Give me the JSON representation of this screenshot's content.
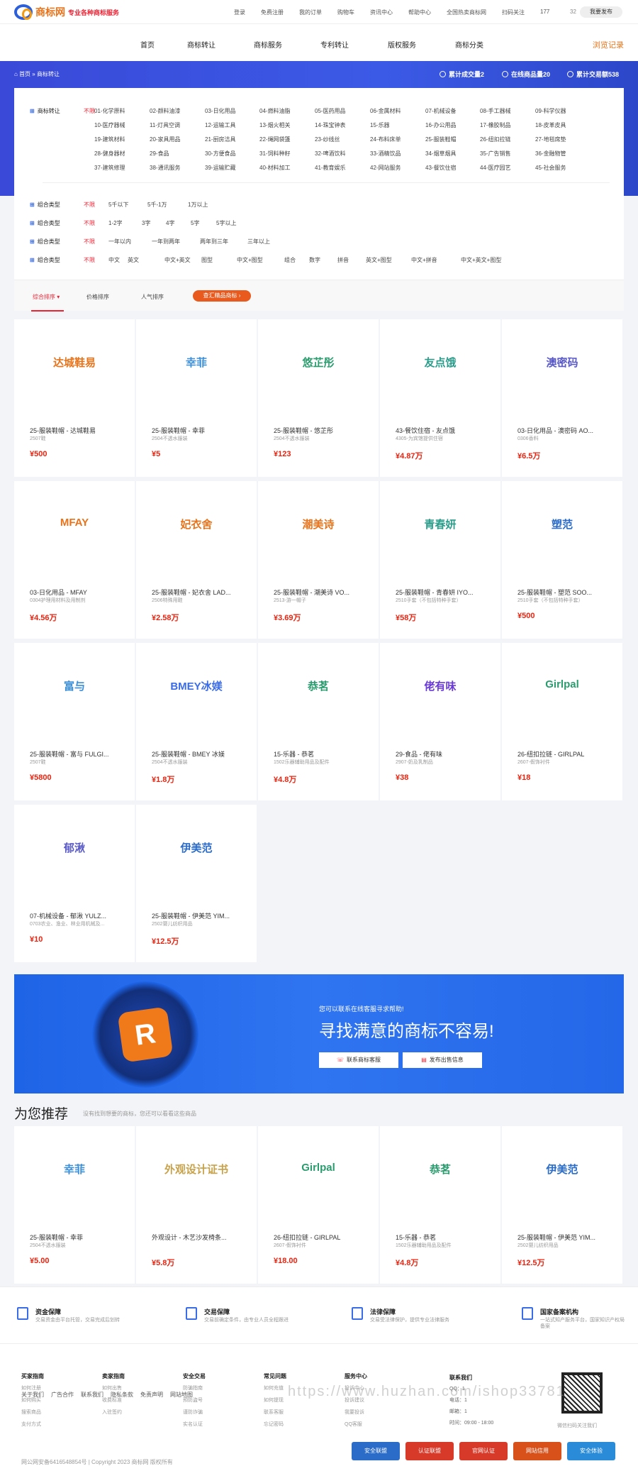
{
  "brand": {
    "name": "商标网",
    "tagline": "专业各种商标服务"
  },
  "toplinks": [
    "登录",
    "免费注册",
    "我的订单",
    "购物车",
    "资讯中心",
    "帮助中心",
    "全国热卖商标网",
    "扫码关注",
    "177"
  ],
  "top_count": "32",
  "top_publish": "我要发布",
  "nav": [
    "首页",
    "商标转让",
    "商标服务",
    "专利转让",
    "版权服务",
    "商标分类"
  ],
  "nav_history": "浏览记录",
  "breadcrumb": "首页 » 商标转让",
  "stats": [
    "累计成交量2",
    "在线商品量20",
    "累计交易额538"
  ],
  "filter": {
    "label_category": "商标转让",
    "nolimit": "不限",
    "categories": [
      "01-化学原料",
      "02-颜料油漆",
      "03-日化用品",
      "04-燃料油脂",
      "05-医药用品",
      "06-金属材料",
      "07-机械设备",
      "08-手工器械",
      "09-科学仪器",
      "10-医疗器械",
      "11-灯具空调",
      "12-运输工具",
      "13-烟火相关",
      "14-珠宝钟表",
      "15-乐器",
      "16-办公用品",
      "17-橡胶制品",
      "18-皮革皮具",
      "19-建筑材料",
      "20-家具用品",
      "21-厨房洁具",
      "22-绳网袋篷",
      "23-纱线丝",
      "24-布料床单",
      "25-服装鞋帽",
      "26-纽扣拉链",
      "27-地毯席垫",
      "28-健身器材",
      "29-食品",
      "30-方便食品",
      "31-饲料种籽",
      "32-啤酒饮料",
      "33-酒精饮品",
      "34-烟草烟具",
      "35-广告销售",
      "36-金融物管",
      "37-建筑修理",
      "38-通讯服务",
      "39-运输贮藏",
      "40-材料加工",
      "41-教育娱乐",
      "42-网站服务",
      "43-餐饮住宿",
      "44-医疗园艺",
      "45-社会服务"
    ],
    "group_label": "组合类型",
    "rows": [
      [
        "5千以下",
        "5千-1万",
        "1万以上"
      ],
      [
        "1-2字",
        "3字",
        "4字",
        "5字",
        "5字以上"
      ],
      [
        "一年以内",
        "一年到两年",
        "两年到三年",
        "三年以上"
      ],
      [
        "中文",
        "英文",
        "中文+英文",
        "图型",
        "中文+图型",
        "组合",
        "数字",
        "拼音",
        "英文+图型",
        "中文+拼音",
        "中文+英文+图型"
      ]
    ]
  },
  "sort": {
    "items": [
      "综合排序",
      "价格排序",
      "人气排序"
    ],
    "bid": "查汇精品商标 ›"
  },
  "colors": {
    "accent": "#e8230f",
    "blue": "#3b6ce8",
    "orange": "#e8731a"
  },
  "listings": [
    {
      "logo": "达城鞋易",
      "color": "#e8731a",
      "title": "25-服装鞋帽 - 达城鞋易",
      "sub": "2507鞋",
      "price": "¥500"
    },
    {
      "logo": "幸菲",
      "color": "#3b8fd8",
      "title": "25-服装鞋帽 - 幸菲",
      "sub": "2504不透水服装",
      "price": "¥5"
    },
    {
      "logo": "悠芷彤",
      "color": "#2a9c6e",
      "title": "25-服装鞋帽 - 悠芷彤",
      "sub": "2504不透水服装",
      "price": "¥123"
    },
    {
      "logo": "友点饿",
      "color": "#2a9c8a",
      "title": "43-餐饮住宿 - 友点饿",
      "sub": "4305-为宾馆提供住宿",
      "price": "¥4.87万"
    },
    {
      "logo": "澳密码",
      "color": "#5a5ac8",
      "title": "03-日化用品 - 澳密码 AO...",
      "sub": "0306香料",
      "price": "¥6.5万"
    },
    {
      "logo": "MFAY",
      "color": "#e8731a",
      "title": "03-日化用品 - MFAY",
      "sub": "0304护理用材料及用制剂",
      "price": "¥4.56万"
    },
    {
      "logo": "妃衣舍",
      "color": "#e8731a",
      "title": "25-服装鞋帽 - 妃衣舍 LAD...",
      "sub": "2506特殊用鞋",
      "price": "¥2.58万"
    },
    {
      "logo": "潮美诗",
      "color": "#e8731a",
      "title": "25-服装鞋帽 - 潮美诗 VO...",
      "sub": "2513-游一帽子",
      "price": "¥3.69万"
    },
    {
      "logo": "青春妍",
      "color": "#2a9c8a",
      "title": "25-服装鞋帽 - 青春妍 IYO...",
      "sub": "2510手套（不包括特种手套）",
      "price": "¥58万"
    },
    {
      "logo": "塑范",
      "color": "#2a6cc8",
      "title": "25-服装鞋帽 - 塑范 SOO...",
      "sub": "2510手套（不包括特种手套）",
      "price": "¥500"
    },
    {
      "logo": "富与",
      "color": "#3b8fd8",
      "title": "25-服装鞋帽 - 富与 FULGI...",
      "sub": "2507鞋",
      "price": "¥5800"
    },
    {
      "logo": "BMEY冰媄",
      "color": "#3b6ce8",
      "title": "25-服装鞋帽 - BMEY 冰媄",
      "sub": "2504不透水服装",
      "price": "¥1.8万"
    },
    {
      "logo": "恭茗",
      "color": "#2a9c6e",
      "title": "15-乐器 - 恭茗",
      "sub": "1502乐器辅助用品及配件",
      "price": "¥4.8万"
    },
    {
      "logo": "佬有味",
      "color": "#6a3ad8",
      "title": "29-食品 - 佬有味",
      "sub": "2907-奶及乳制品",
      "price": "¥38"
    },
    {
      "logo": "Girlpal",
      "color": "#2a9c6e",
      "title": "26-纽扣拉链 - GIRLPAL",
      "sub": "2607-假饰衬件",
      "price": "¥18"
    },
    {
      "logo": "郁湫",
      "color": "#5a5ac8",
      "title": "07-机械设备 - 郁湫 YULZ...",
      "sub": "0703农业、渔业、林业用机械及...",
      "price": "¥10"
    },
    {
      "logo": "伊美范",
      "color": "#2a6cc8",
      "title": "25-服装鞋帽 - 伊美范 YIM...",
      "sub": "2502婴儿纺织用品",
      "price": "¥12.5万"
    }
  ],
  "promo": {
    "small": "您可以联系在线客服寻求帮助!",
    "big": "寻找满意的商标不容易!",
    "btn1": "联系商标客服",
    "btn2": "发布出售信息"
  },
  "recommend": {
    "title": "为您推荐",
    "sub": "没有找到想要的商标，您还可以看看这些商品"
  },
  "recs": [
    {
      "logo": "幸菲",
      "color": "#3b8fd8",
      "title": "25-服装鞋帽 - 幸菲",
      "sub": "2504不透水服装",
      "price": "¥5.00"
    },
    {
      "logo": "外观设计证书",
      "color": "#c8a24a",
      "title": "外观设计 - 木艺沙发椅条...",
      "sub": "",
      "price": "¥5.8万"
    },
    {
      "logo": "Girlpal",
      "color": "#2a9c6e",
      "title": "26-纽扣拉链 - GIRLPAL",
      "sub": "2607-假饰衬件",
      "price": "¥18.00"
    },
    {
      "logo": "恭茗",
      "color": "#2a9c6e",
      "title": "15-乐器 - 恭茗",
      "sub": "1502乐器辅助用品及配件",
      "price": "¥4.8万"
    },
    {
      "logo": "伊美范",
      "color": "#2a6cc8",
      "title": "25-服装鞋帽 - 伊美范 YIM...",
      "sub": "2502婴儿纺织用品",
      "price": "¥12.5万"
    }
  ],
  "guarantees": [
    {
      "h": "资金保障",
      "d": "交易资金由平台托管，交易完成后划转"
    },
    {
      "h": "交易保障",
      "d": "交易前确定条件，由专业人员全程跟进"
    },
    {
      "h": "法律保障",
      "d": "交易受法律保护，提供专业法律服务"
    },
    {
      "h": "国家备案机构",
      "d": "一站式知产服务平台，国家知识产权局备案"
    }
  ],
  "footer_cols": [
    {
      "h": "买家指南",
      "links": [
        "如何注册",
        "如何购买",
        "搜索商品",
        "支付方式"
      ]
    },
    {
      "h": "卖家指南",
      "links": [
        "如何出售",
        "收费标准",
        "入驻签约"
      ]
    },
    {
      "h": "安全交易",
      "links": [
        "防骗指南",
        "预防盗号",
        "谨防诈骗",
        "实名认证"
      ]
    },
    {
      "h": "常见问题",
      "links": [
        "如何充值",
        "如何提现",
        "联系客服",
        "忘记密码"
      ]
    },
    {
      "h": "服务中心",
      "links": [
        "投诉中心",
        "投诉建议",
        "我要投诉",
        "QQ客服"
      ]
    }
  ],
  "contact": {
    "h": "联系我们",
    "qq": "QQ：1",
    "phone": "电话：1",
    "mail": "邮箱：1",
    "time": "时间：09:00 - 18:00"
  },
  "qr_caption": "微信扫码关注我们",
  "bottom_links": [
    "关于我们",
    "广告合作",
    "联系我们",
    "隐私条款",
    "免责声明",
    "网站地图"
  ],
  "copyright": "网公网安备6416548854号 | Copyright 2023 商标网 版权所有",
  "badges": [
    "安全联盟",
    "认证联盟",
    "官网认证",
    "网站信用",
    "安全体验"
  ],
  "watermark": "https://www.huzhan.com/ishop33781"
}
